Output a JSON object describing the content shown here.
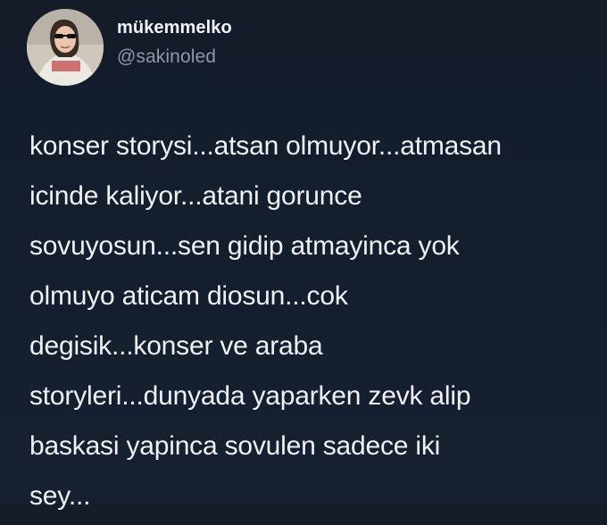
{
  "user": {
    "display_name": "mükemmelko",
    "handle": "@sakinoled"
  },
  "tweet": {
    "lines": [
      "konser storysi...atsan olmuyor...atmasan",
      "icinde kaliyor...atani gorunce",
      "sovuyosun...sen gidip atmayinca yok",
      "olmuyo aticam diosun...cok",
      "degisik...konser ve araba",
      "storyleri...dunyada yaparken zevk alip",
      "baskasi yapinca sovulen sadece iki",
      "sey..."
    ]
  },
  "colors": {
    "background": "#151d2b",
    "text": "#eef1f5",
    "handle": "#8c97a5"
  }
}
